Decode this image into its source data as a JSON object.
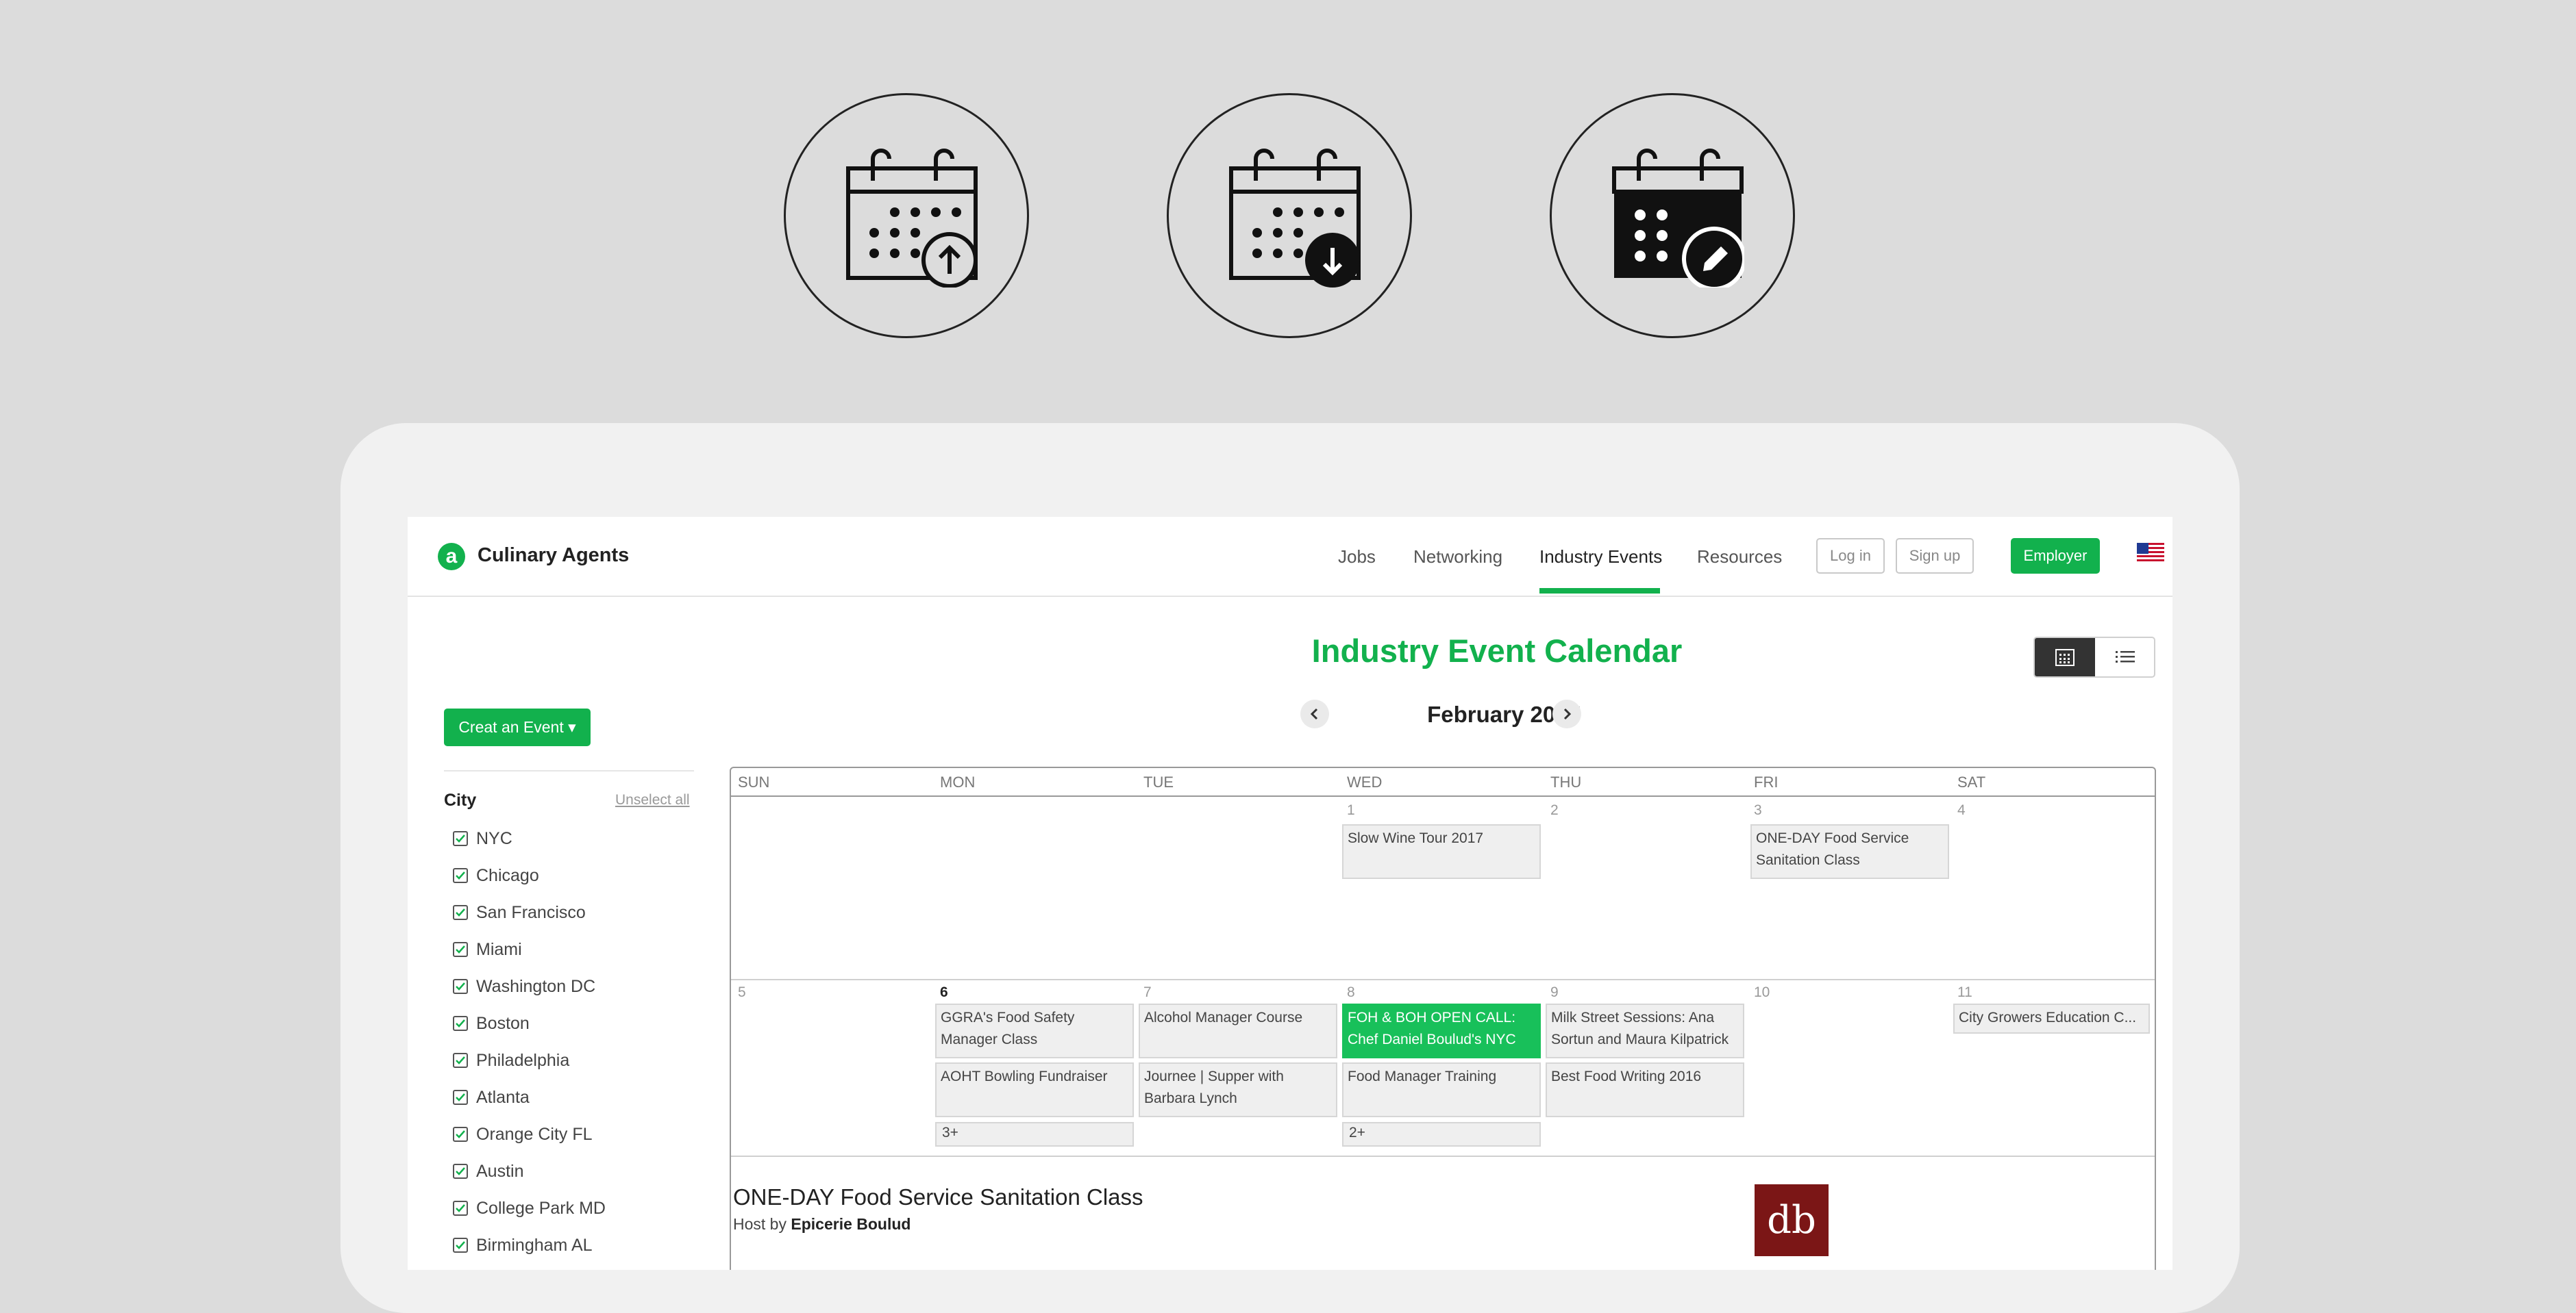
{
  "hero_icons": [
    "calendar-upload-icon",
    "calendar-download-icon",
    "calendar-edit-icon"
  ],
  "colors": {
    "accent": "#12b14d",
    "highlight_event": "#18c05a",
    "background": "#dcdcdc"
  },
  "header": {
    "brand": "Culinary Agents",
    "logo_letter": "a",
    "nav": [
      "Jobs",
      "Networking",
      "Industry Events",
      "Resources"
    ],
    "active_nav": "Industry Events",
    "login": "Log in",
    "signup": "Sign up",
    "employer": "Employer"
  },
  "page": {
    "title": "Industry Event Calendar",
    "month": "February 2017",
    "create_event": "Creat an Event ▾"
  },
  "sidebar": {
    "heading": "City",
    "unselect": "Unselect all",
    "cities": [
      "NYC",
      "Chicago",
      "San Francisco",
      "Miami",
      "Washington DC",
      "Boston",
      "Philadelphia",
      "Atlanta",
      "Orange City FL",
      "Austin",
      "College Park MD",
      "Birmingham AL"
    ]
  },
  "calendar": {
    "weekdays": [
      "SUN",
      "MON",
      "TUE",
      "WED",
      "THU",
      "FRI",
      "SAT"
    ],
    "week1": {
      "days": [
        "1",
        "2",
        "3",
        "4"
      ],
      "events": {
        "wed": "Slow Wine Tour 2017",
        "fri": "ONE-DAY Food Service Sanitation Class"
      }
    },
    "week2": {
      "days": [
        "5",
        "6",
        "7",
        "8",
        "9",
        "10",
        "11"
      ],
      "events": {
        "mon": [
          "GGRA's Food Safety Manager Class",
          "AOHT Bowling Fundraiser"
        ],
        "tue": [
          "Alcohol Manager Course",
          "Journee | Supper with Barbara Lynch"
        ],
        "wed": [
          "FOH & BOH OPEN CALL: Chef Daniel Boulud's NYC",
          "Food Manager Training"
        ],
        "thu": [
          "Milk Street Sessions: Ana Sortun and Maura Kilpatrick",
          "Best Food Writing 2016"
        ],
        "sat": [
          "City Growers Education C..."
        ]
      },
      "more": {
        "mon": "3+",
        "wed": "2+"
      }
    }
  },
  "detail": {
    "title": "ONE-DAY Food Service Sanitation Class",
    "host_prefix": "Host by",
    "host": "Epicerie Boulud",
    "logo_text": "db"
  }
}
